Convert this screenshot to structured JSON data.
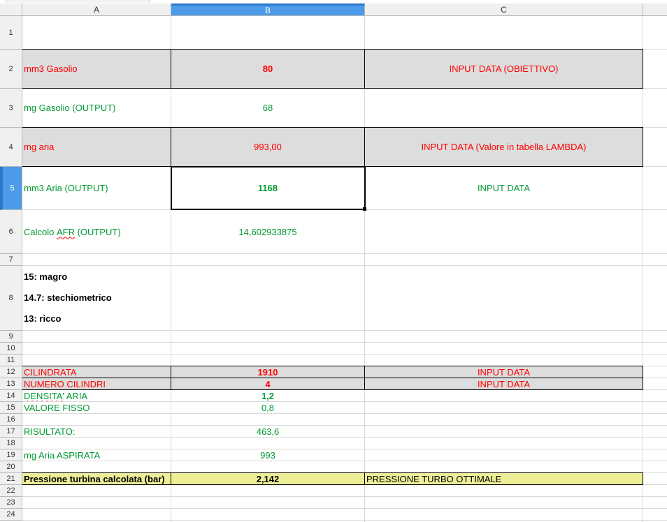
{
  "columns": [
    "A",
    "B",
    "C"
  ],
  "selected_column": "B",
  "selected_row": "5",
  "rows": [
    "1",
    "2",
    "3",
    "4",
    "5",
    "6",
    "7",
    "8",
    "9",
    "10",
    "11",
    "12",
    "13",
    "14",
    "15",
    "16",
    "17",
    "18",
    "19",
    "20",
    "21",
    "22",
    "23",
    "24"
  ],
  "cells": {
    "A2": "mm3 Gasolio",
    "B2": "80",
    "C2": "INPUT DATA (OBIETTIVO)",
    "A3": "mg Gasolio (OUTPUT)",
    "B3": "68",
    "A4": "mg aria",
    "B4": "993,00",
    "C4": "INPUT DATA (Valore in tabella LAMBDA)",
    "A5": "mm3 Aria (OUTPUT)",
    "B5": "1168",
    "C5": "INPUT DATA",
    "A6_pre": "Calcolo ",
    "A6_word": "AFR",
    "A6_post": " (OUTPUT)",
    "B6": "14,602933875",
    "A8_line1": "15: magro",
    "A8_line2": "14.7: stechiometrico",
    "A8_line3": "13: ricco",
    "A12": "CILINDRATA",
    "B12": "1910",
    "C12": "INPUT DATA",
    "A13": "NUMERO CILINDRI",
    "B13": "4",
    "C13": "INPUT DATA",
    "A14_word": "DENSITA'",
    "A14_post": " ARIA",
    "B14": "1,2",
    "A15": "VALORE FISSO",
    "B15": "0,8",
    "A17": "RISULTATO:",
    "B17": "463,6",
    "A19": "mg Aria ASPIRATA",
    "B19": "993",
    "A21": "Pressione turbina calcolata (bar)",
    "B21": "2,142",
    "C21": "PRESSIONE TURBO OTTIMALE"
  },
  "colors": {
    "input_red": "#ff0000",
    "output_green": "#009933",
    "selection_blue": "#4d9be8",
    "input_band_gray": "#dddddd",
    "result_band_yellow": "#eeee99"
  }
}
